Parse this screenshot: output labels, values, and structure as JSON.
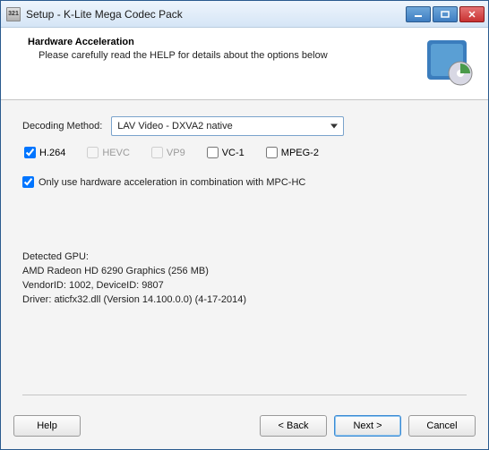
{
  "window": {
    "title": "Setup - K-Lite Mega Codec Pack"
  },
  "header": {
    "title": "Hardware Acceleration",
    "subtitle": "Please carefully read the HELP for details about the options below"
  },
  "decoding": {
    "label": "Decoding Method:",
    "selected": "LAV Video - DXVA2 native"
  },
  "codecs": {
    "h264": "H.264",
    "hevc": "HEVC",
    "vp9": "VP9",
    "vc1": "VC-1",
    "mpeg2": "MPEG-2"
  },
  "mpc_option": "Only use hardware acceleration in combination with MPC-HC",
  "gpu": {
    "heading": "Detected GPU:",
    "model": "AMD Radeon HD 6290 Graphics (256 MB)",
    "ids": "VendorID: 1002, DeviceID: 9807",
    "driver": "Driver: aticfx32.dll (Version 14.100.0.0) (4-17-2014)"
  },
  "footer": {
    "help": "Help",
    "back": "< Back",
    "next": "Next >",
    "cancel": "Cancel"
  }
}
